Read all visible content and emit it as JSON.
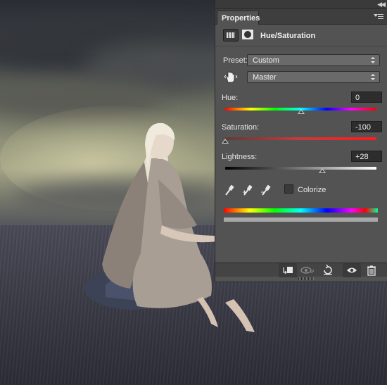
{
  "panel": {
    "tab_label": "Properties",
    "adjustment_title": "Hue/Saturation",
    "preset": {
      "label": "Preset:",
      "value": "Custom"
    },
    "channel": {
      "value": "Master"
    },
    "hue": {
      "label": "Hue:",
      "value": "0",
      "slider_fraction": 0.5
    },
    "saturation": {
      "label": "Saturation:",
      "value": "-100",
      "slider_fraction": 0.0
    },
    "lightness": {
      "label": "Lightness:",
      "value": "+28",
      "slider_fraction": 0.64
    },
    "colorize": {
      "label": "Colorize",
      "checked": false
    }
  },
  "icons": {
    "collapse": "double-chevron-left-icon",
    "panel_menu": "panel-menu-icon",
    "adjustment": "hue-saturation-adjustment-icon",
    "mask": "layer-mask-icon",
    "hand": "targeted-adjustment-hand-icon",
    "eyedroppers": [
      "eyedropper-icon",
      "eyedropper-add-icon",
      "eyedropper-subtract-icon"
    ],
    "footer": [
      "clip-to-layer-icon",
      "view-previous-state-icon",
      "reset-icon",
      "visibility-eye-icon",
      "trash-icon"
    ]
  },
  "colors": {
    "panel_bg": "#535353",
    "field_bg": "#2d2d2d",
    "tab_bar": "#3e3e3e"
  }
}
